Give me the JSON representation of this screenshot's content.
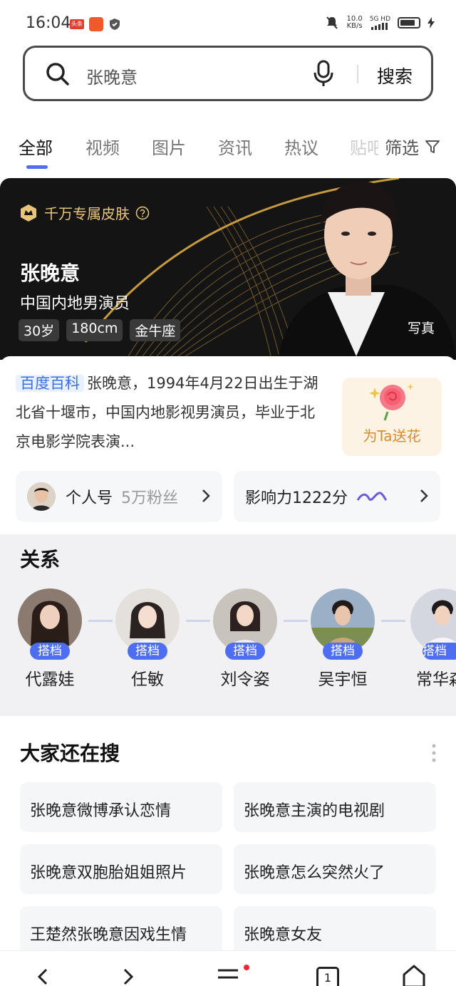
{
  "status": {
    "time": "16:04",
    "app1": "头条",
    "netspeed_value": "10.0",
    "netspeed_unit": "KB/s",
    "signal": "5G HD"
  },
  "search": {
    "query": "张晚意",
    "button": "搜索"
  },
  "tabs": [
    "全部",
    "视频",
    "图片",
    "资讯",
    "热议",
    "贴吧"
  ],
  "filter_label": "筛选",
  "hero": {
    "badge": "千万专属皮肤",
    "name": "张晚意",
    "title": "中国内地男演员",
    "chips": [
      "30岁",
      "180cm",
      "金牛座"
    ],
    "photo_link": "写真"
  },
  "baike": {
    "tag": "百度百科",
    "text": "张晚意，1994年4月22日出生于湖北省十堰市，中国内地影视男演员，毕业于北京电影学院表演...",
    "flower_label": "为Ta送花",
    "personal": {
      "label": "个人号",
      "fans": "5万粉丝"
    },
    "influence": "影响力1222分"
  },
  "relations": {
    "title": "关系",
    "items": [
      {
        "tag": "搭档",
        "name": "代露娃",
        "color": "#6e5a4e"
      },
      {
        "tag": "搭档",
        "name": "任敏",
        "color": "#d9d4cf"
      },
      {
        "tag": "搭档",
        "name": "刘令姿",
        "color": "#bfb8b2"
      },
      {
        "tag": "搭档",
        "name": "吴宇恒",
        "color": "#8a9b6a"
      },
      {
        "tag": "搭档",
        "name": "常华森",
        "color": "#c7c9d4"
      }
    ]
  },
  "also": {
    "title": "大家还在搜",
    "items": [
      "张晚意微博承认恋情",
      "张晚意主演的电视剧",
      "张晚意双胞胎姐姐照片",
      "张晚意怎么突然火了",
      "王楚然张晚意因戏生情",
      "张晚意女友"
    ]
  },
  "nav": {
    "tab_count": "1"
  },
  "colors": {
    "accent": "#4e6ef2",
    "gold": "#e8c57a"
  }
}
